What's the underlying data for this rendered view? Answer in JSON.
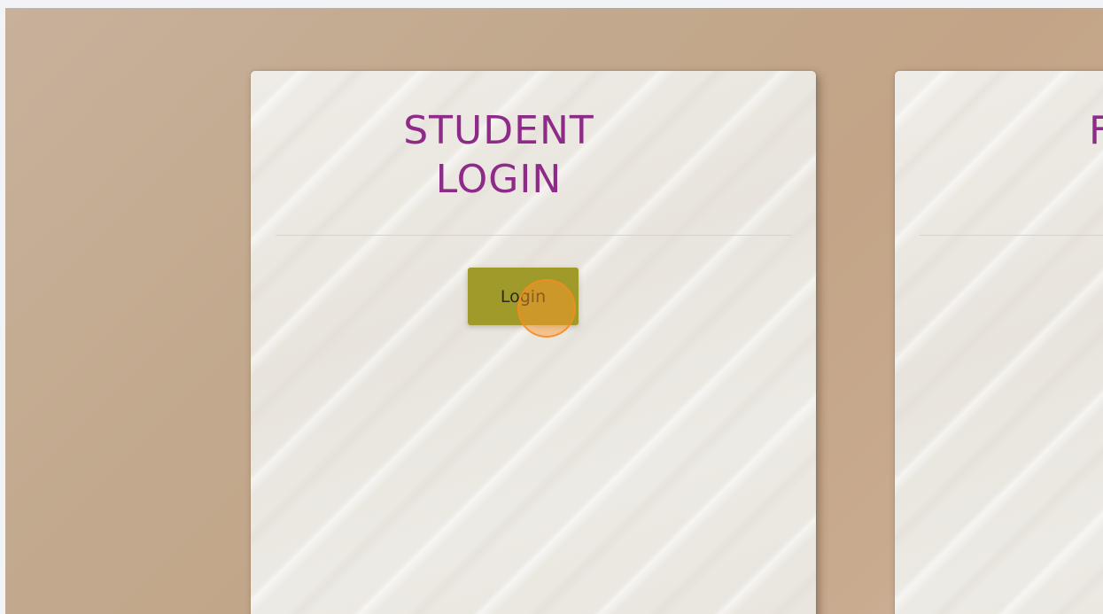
{
  "student_card": {
    "title_line1": "STUDENT",
    "title_line2": "LOGIN",
    "login_button": "Login"
  },
  "second_card": {
    "title_partial": "F"
  },
  "colors": {
    "title": "#8e2a87",
    "login_button_bg": "#a09a2a",
    "click_indicator": "#ff9628"
  }
}
